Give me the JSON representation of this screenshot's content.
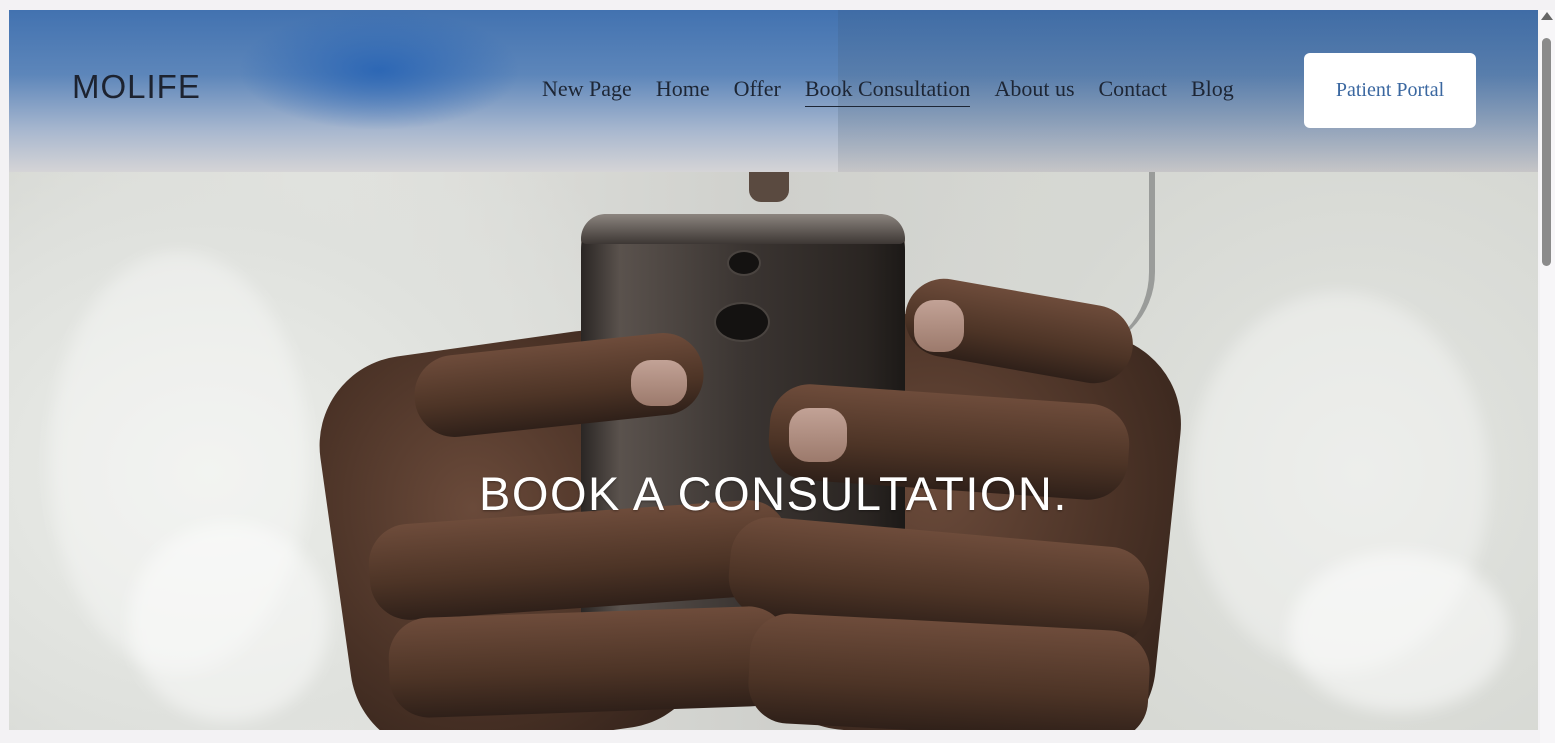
{
  "header": {
    "logo": "MOLIFE",
    "nav": [
      {
        "label": "New Page",
        "active": false
      },
      {
        "label": "Home",
        "active": false
      },
      {
        "label": "Offer",
        "active": false
      },
      {
        "label": "Book Consultation",
        "active": true
      },
      {
        "label": "About us",
        "active": false
      },
      {
        "label": "Contact",
        "active": false
      },
      {
        "label": "Blog",
        "active": false
      }
    ],
    "portal_button": "Patient Portal"
  },
  "hero": {
    "title": "BOOK A CONSULTATION.",
    "image_alt": "hands-holding-phone-doctor-coat"
  },
  "colors": {
    "header_top": "#4272b0",
    "portal_text": "#3a67a0",
    "nav_text": "#1d2635",
    "hero_title": "#ffffff"
  }
}
